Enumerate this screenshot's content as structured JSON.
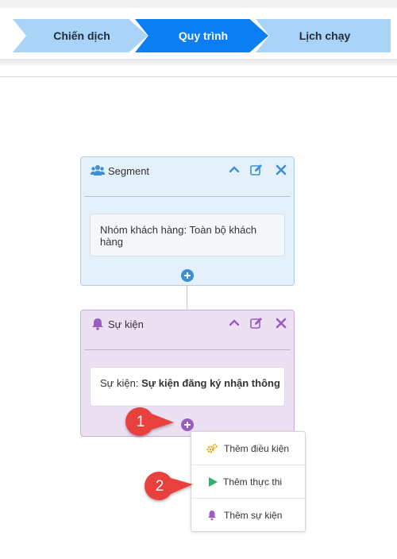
{
  "steps": [
    {
      "label": "Chiến dịch",
      "state": "inactive"
    },
    {
      "label": "Quy trình",
      "state": "active"
    },
    {
      "label": "Lịch chạy",
      "state": "inactive"
    }
  ],
  "segment_card": {
    "title": "Segment",
    "icon": "users-icon",
    "body_label": "Nhóm khách hàng:",
    "body_value": "Toàn bộ khách hàng",
    "accent": "#3b8fd6"
  },
  "event_card": {
    "title": "Sự kiện",
    "icon": "bell-icon",
    "body_label": "Sự kiện:",
    "body_value": "Sự kiện đăng ký nhận thông",
    "accent": "#9a5cc3"
  },
  "add_menu": {
    "items": [
      {
        "label": "Thêm điều kiện",
        "icon": "gears-icon"
      },
      {
        "label": "Thêm thực thi",
        "icon": "play-icon"
      },
      {
        "label": "Thêm sự kiện",
        "icon": "bell-icon"
      }
    ]
  },
  "callouts": [
    "1",
    "2"
  ],
  "colors": {
    "step_active": "#0a7ef3",
    "step_inactive": "#a9d3f7",
    "callout": "#e8413c"
  }
}
